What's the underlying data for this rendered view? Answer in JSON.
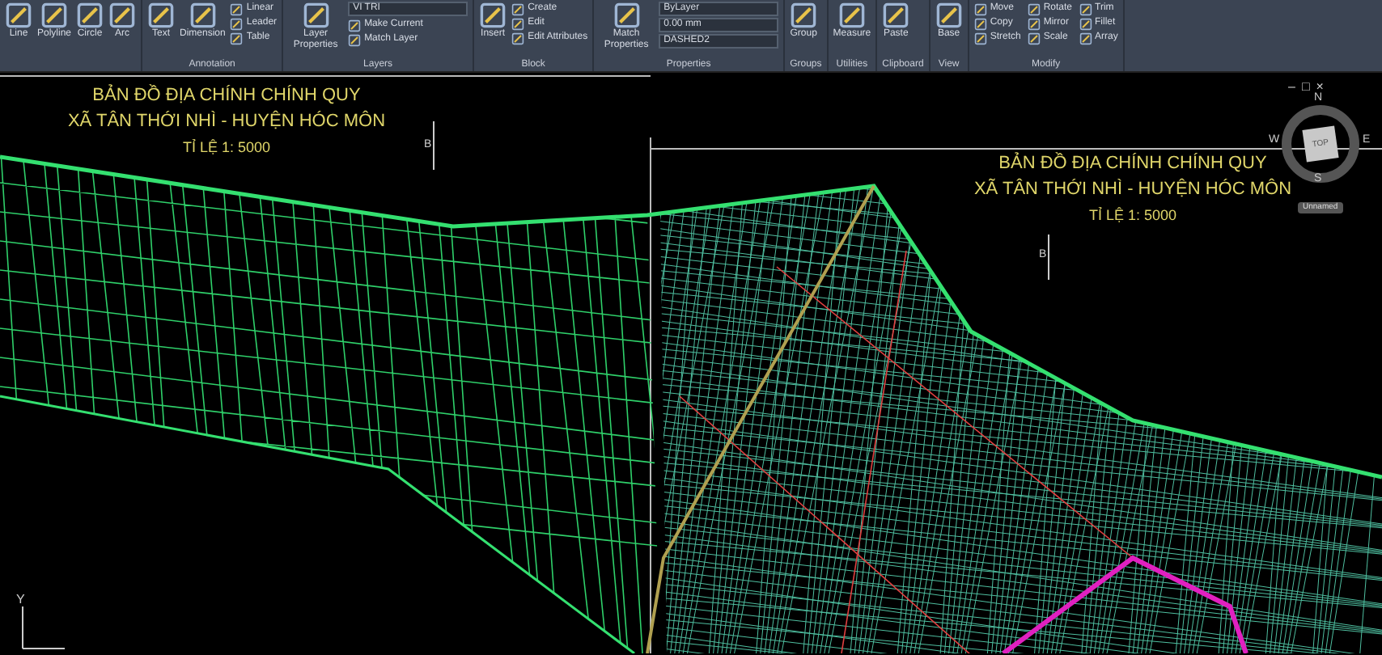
{
  "ribbon": {
    "groups": [
      {
        "tools": [
          {
            "label": "Line",
            "kind": "large"
          },
          {
            "label": "Polyline",
            "kind": "large"
          },
          {
            "label": "Circle",
            "kind": "large"
          },
          {
            "label": "Arc",
            "kind": "large"
          }
        ]
      },
      {
        "label": "Annotation",
        "tools": [
          {
            "label": "Text",
            "kind": "large"
          },
          {
            "label": "Dimension",
            "kind": "large"
          },
          {
            "label": "Linear",
            "kind": "small"
          },
          {
            "label": "Leader",
            "kind": "small"
          },
          {
            "label": "Table",
            "kind": "small"
          }
        ]
      },
      {
        "label": "Layers",
        "tools": [
          {
            "label": "Layer Properties",
            "kind": "large"
          },
          {
            "label": "VI TRI",
            "kind": "dropdown"
          },
          {
            "label": "Make Current",
            "kind": "small"
          },
          {
            "label": "Match Layer",
            "kind": "small"
          }
        ]
      },
      {
        "label": "Block",
        "tools": [
          {
            "label": "Insert",
            "kind": "large"
          },
          {
            "label": "Create",
            "kind": "small"
          },
          {
            "label": "Edit",
            "kind": "small"
          },
          {
            "label": "Edit Attributes",
            "kind": "small"
          }
        ]
      },
      {
        "label": "Properties",
        "tools": [
          {
            "label": "Match Properties",
            "kind": "large"
          },
          {
            "label": "ByLayer",
            "kind": "dropdown"
          },
          {
            "label": "0.00 mm",
            "kind": "dropdown"
          },
          {
            "label": "DASHED2",
            "kind": "dropdown"
          }
        ]
      },
      {
        "label": "Groups",
        "tools": [
          {
            "label": "Group",
            "kind": "large"
          }
        ]
      },
      {
        "label": "Utilities",
        "tools": [
          {
            "label": "Measure",
            "kind": "large"
          }
        ]
      },
      {
        "label": "Clipboard",
        "tools": [
          {
            "label": "Paste",
            "kind": "large"
          }
        ]
      },
      {
        "label": "View",
        "tools": [
          {
            "label": "Base",
            "kind": "large"
          }
        ]
      },
      {
        "label": "Modify",
        "tools": [
          {
            "label": "Move",
            "kind": "small"
          },
          {
            "label": "Copy",
            "kind": "small"
          },
          {
            "label": "Stretch",
            "kind": "small"
          },
          {
            "label": "Rotate",
            "kind": "small"
          },
          {
            "label": "Mirror",
            "kind": "small"
          },
          {
            "label": "Scale",
            "kind": "small"
          },
          {
            "label": "Trim",
            "kind": "small"
          },
          {
            "label": "Fillet",
            "kind": "small"
          },
          {
            "label": "Array",
            "kind": "small"
          }
        ]
      }
    ]
  },
  "drawing": {
    "titles": [
      {
        "lines": [
          "BẢN ĐỒ ĐỊA CHÍNH CHÍNH QUY",
          "XÃ TÂN THỚI NHÌ - HUYỆN HÓC MÔN",
          "TỈ LỆ 1: 5000"
        ]
      },
      {
        "lines": [
          "BẢN ĐỒ ĐỊA CHÍNH CHÍNH QUY",
          "XÃ TÂN THỚI NHÌ - HUYỆN HÓC MÔN",
          "TỈ LỆ 1: 5000"
        ]
      }
    ],
    "markers": [
      "B",
      "B"
    ],
    "viewport_controls": [
      "–",
      "□",
      "×"
    ],
    "viewcube": {
      "face": "TOP",
      "north": "N",
      "east": "E",
      "south": "S",
      "west": "W",
      "view_label": "Unnamed"
    },
    "ucs_label": "Y"
  }
}
